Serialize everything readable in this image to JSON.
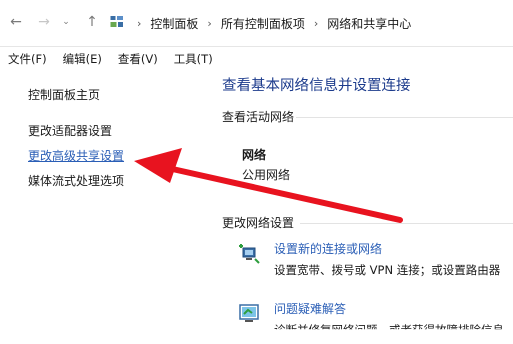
{
  "address_bar": {
    "crumbs": [
      "控制面板",
      "所有控制面板项",
      "网络和共享中心"
    ]
  },
  "menu": [
    "文件(F)",
    "编辑(E)",
    "查看(V)",
    "工具(T)"
  ],
  "left_pane": {
    "items": [
      "控制面板主页",
      "更改适配器设置",
      "更改高级共享设置",
      "媒体流式处理选项"
    ],
    "highlighted_index": 2
  },
  "main": {
    "title": "查看基本网络信息并设置连接",
    "active_header": "查看活动网络",
    "network_name": "网络",
    "network_type": "公用网络",
    "change_header": "更改网络设置",
    "tasks": [
      {
        "link": "设置新的连接或网络",
        "desc": "设置宽带、拨号或 VPN 连接；或设置路由器"
      },
      {
        "link": "问题疑难解答",
        "desc": "诊断并修复网络问题，或者获得故障排除信息"
      }
    ]
  },
  "annotation": {
    "arrow_color": "#e8131f"
  },
  "colors": {
    "link": "#2a5eb6",
    "title": "#1c3b8c"
  }
}
